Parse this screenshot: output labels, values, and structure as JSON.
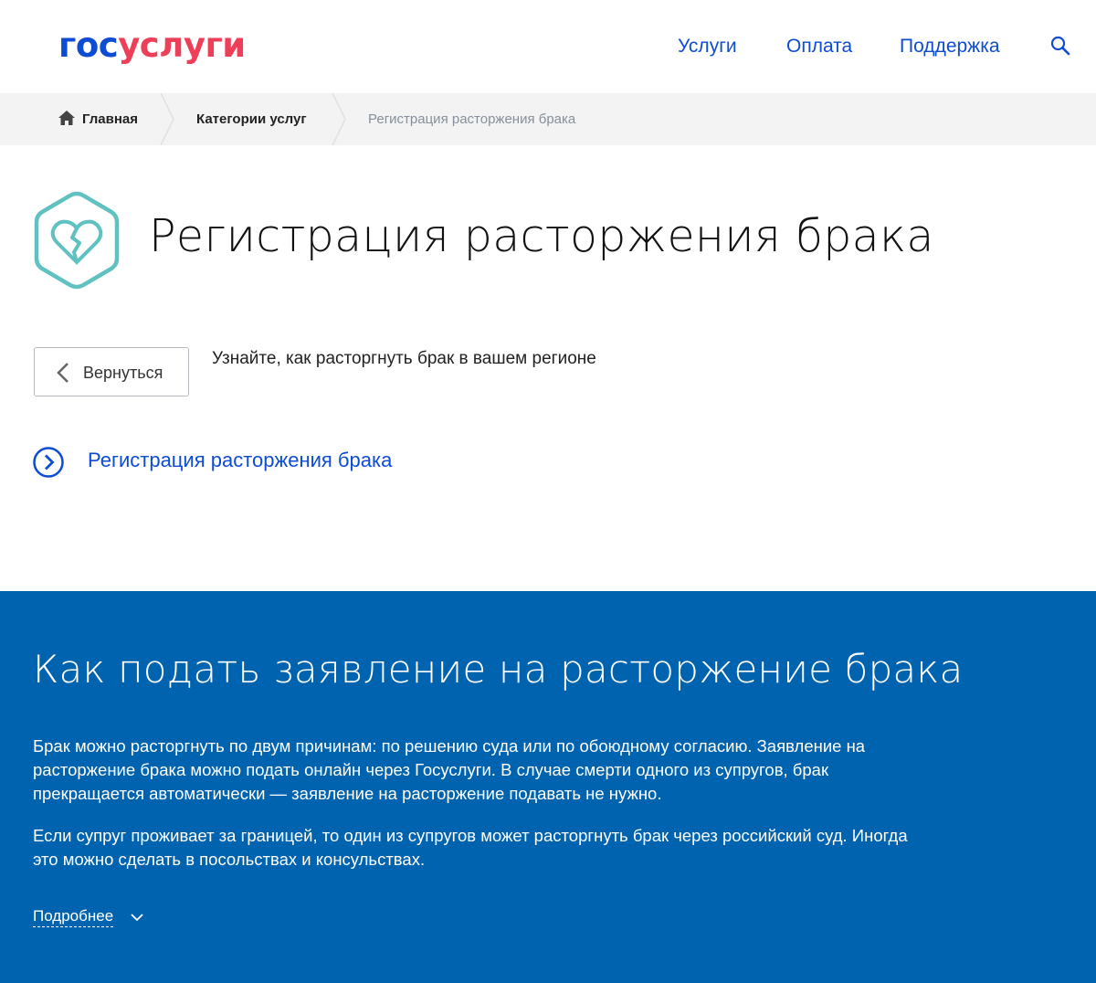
{
  "header": {
    "logo_part1": "гос",
    "logo_part2": "услуги",
    "nav": [
      "Услуги",
      "Оплата",
      "Поддержка"
    ],
    "search_icon": "search-icon"
  },
  "breadcrumb": {
    "home": "Главная",
    "category": "Категории услуг",
    "current": "Регистрация расторжения брака"
  },
  "page": {
    "title": "Регистрация расторжения брака",
    "title_icon": "broken-heart-icon",
    "back_label": "Вернуться",
    "intro": "Узнайте, как расторгнуть брак в вашем регионе",
    "service_link": "Регистрация расторжения брака"
  },
  "info": {
    "title": "Как подать заявление на расторжение брака",
    "paragraph1_lines": [
      "Брак можно расторгнуть по двум причинам: по решению суда или по обоюдному согласию. Заявление на",
      "расторжение брака можно подать онлайн через Госуслуги. В случае смерти одного из супругов, брак",
      "прекращается автоматически — заявление на расторжение подавать не нужно."
    ],
    "paragraph2_lines": [
      "Если супруг проживает за границей, то один из супругов может расторгнуть брак через российский суд. Иногда",
      "это можно сделать в посольствах и консульствах."
    ],
    "more": "Подробнее"
  },
  "colors": {
    "brand_blue": "#0d4cd3",
    "brand_red": "#ee3f58",
    "info_bg": "#0063b0",
    "icon_teal": "#5fc1c0"
  }
}
